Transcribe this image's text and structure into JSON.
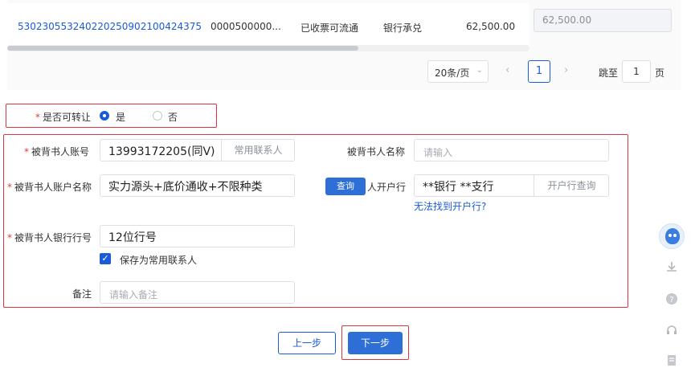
{
  "table": {
    "row": {
      "bill_no": "530230553240220250902100424375",
      "sub_range": "0000500000...",
      "status": "已收票可流通",
      "type": "银行承兑",
      "amount": "62,500.00",
      "transfer_amount": "62,500.00"
    }
  },
  "pagination": {
    "page_size": "20条/页",
    "current_page": "1",
    "jump_prefix": "跳至",
    "jump_value": "1",
    "jump_suffix": "页"
  },
  "form": {
    "transferable": {
      "label": "是否可转让",
      "options": [
        "是",
        "否"
      ],
      "selected": "是"
    },
    "endorsee_account": {
      "label": "被背书人账号",
      "value": "13993172205(同V)",
      "suffix_button": "常用联系人"
    },
    "endorsee_name": {
      "label": "被背书人名称",
      "placeholder": "请输入"
    },
    "endorsee_account_name": {
      "label": "被背书人账户名称",
      "value": "实力源头+底价通收+不限种类"
    },
    "query_button": "查询",
    "endorsee_bank": {
      "label": "人开户行",
      "value": "**银行 **支行",
      "suffix_button": "开户行查询",
      "help_link": "无法找到开户行?"
    },
    "endorsee_bank_code": {
      "label": "被背书人银行行号",
      "value": "12位行号"
    },
    "save_contact": {
      "label": "保存为常用联系人",
      "checked": true
    },
    "remark": {
      "label": "备注",
      "placeholder": "请输入备注"
    }
  },
  "actions": {
    "prev": "上一步",
    "next": "下一步"
  },
  "float_toolbar": [
    "assistant-avatar-icon",
    "download-icon",
    "help-icon",
    "headset-icon",
    "document-icon"
  ],
  "colors": {
    "primary": "#2d6fd6",
    "link": "#1a5bd7",
    "highlight_border": "#d9363e",
    "required": "#e23b3b"
  }
}
